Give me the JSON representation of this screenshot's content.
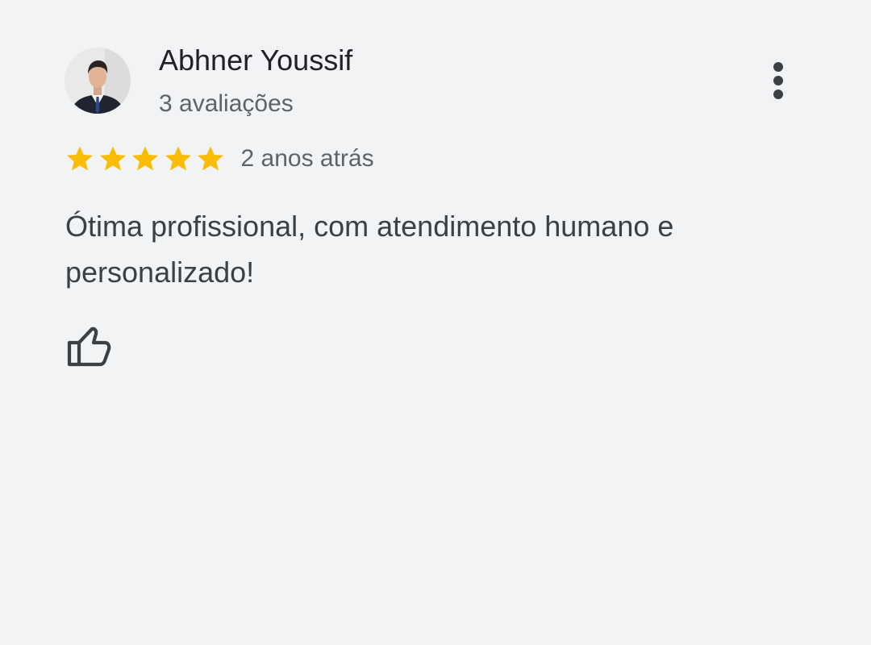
{
  "review": {
    "reviewer_name": "Abhner Youssif",
    "review_count": "3 avaliações",
    "rating": 5,
    "rating_max": 5,
    "date": "2 anos atrás",
    "text": "Ótima profissional, com atendimento humano e personalizado!"
  },
  "icons": {
    "more": "more-vert-icon",
    "star": "star-icon",
    "like": "thumbs-up-icon"
  },
  "colors": {
    "background": "#f2f3f5",
    "star": "#fbbc04",
    "name": "#202124",
    "secondary_text": "#5f6368",
    "body_text": "#3c4043"
  }
}
